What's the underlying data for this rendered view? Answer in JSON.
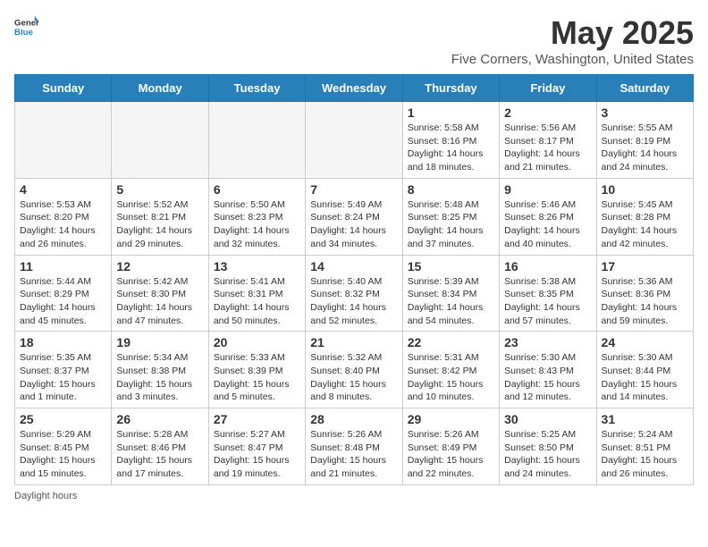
{
  "header": {
    "logo_general": "General",
    "logo_blue": "Blue",
    "title": "May 2025",
    "subtitle": "Five Corners, Washington, United States"
  },
  "weekdays": [
    "Sunday",
    "Monday",
    "Tuesday",
    "Wednesday",
    "Thursday",
    "Friday",
    "Saturday"
  ],
  "weeks": [
    [
      {
        "day": "",
        "info": ""
      },
      {
        "day": "",
        "info": ""
      },
      {
        "day": "",
        "info": ""
      },
      {
        "day": "",
        "info": ""
      },
      {
        "day": "1",
        "info": "Sunrise: 5:58 AM\nSunset: 8:16 PM\nDaylight: 14 hours\nand 18 minutes."
      },
      {
        "day": "2",
        "info": "Sunrise: 5:56 AM\nSunset: 8:17 PM\nDaylight: 14 hours\nand 21 minutes."
      },
      {
        "day": "3",
        "info": "Sunrise: 5:55 AM\nSunset: 8:19 PM\nDaylight: 14 hours\nand 24 minutes."
      }
    ],
    [
      {
        "day": "4",
        "info": "Sunrise: 5:53 AM\nSunset: 8:20 PM\nDaylight: 14 hours\nand 26 minutes."
      },
      {
        "day": "5",
        "info": "Sunrise: 5:52 AM\nSunset: 8:21 PM\nDaylight: 14 hours\nand 29 minutes."
      },
      {
        "day": "6",
        "info": "Sunrise: 5:50 AM\nSunset: 8:23 PM\nDaylight: 14 hours\nand 32 minutes."
      },
      {
        "day": "7",
        "info": "Sunrise: 5:49 AM\nSunset: 8:24 PM\nDaylight: 14 hours\nand 34 minutes."
      },
      {
        "day": "8",
        "info": "Sunrise: 5:48 AM\nSunset: 8:25 PM\nDaylight: 14 hours\nand 37 minutes."
      },
      {
        "day": "9",
        "info": "Sunrise: 5:46 AM\nSunset: 8:26 PM\nDaylight: 14 hours\nand 40 minutes."
      },
      {
        "day": "10",
        "info": "Sunrise: 5:45 AM\nSunset: 8:28 PM\nDaylight: 14 hours\nand 42 minutes."
      }
    ],
    [
      {
        "day": "11",
        "info": "Sunrise: 5:44 AM\nSunset: 8:29 PM\nDaylight: 14 hours\nand 45 minutes."
      },
      {
        "day": "12",
        "info": "Sunrise: 5:42 AM\nSunset: 8:30 PM\nDaylight: 14 hours\nand 47 minutes."
      },
      {
        "day": "13",
        "info": "Sunrise: 5:41 AM\nSunset: 8:31 PM\nDaylight: 14 hours\nand 50 minutes."
      },
      {
        "day": "14",
        "info": "Sunrise: 5:40 AM\nSunset: 8:32 PM\nDaylight: 14 hours\nand 52 minutes."
      },
      {
        "day": "15",
        "info": "Sunrise: 5:39 AM\nSunset: 8:34 PM\nDaylight: 14 hours\nand 54 minutes."
      },
      {
        "day": "16",
        "info": "Sunrise: 5:38 AM\nSunset: 8:35 PM\nDaylight: 14 hours\nand 57 minutes."
      },
      {
        "day": "17",
        "info": "Sunrise: 5:36 AM\nSunset: 8:36 PM\nDaylight: 14 hours\nand 59 minutes."
      }
    ],
    [
      {
        "day": "18",
        "info": "Sunrise: 5:35 AM\nSunset: 8:37 PM\nDaylight: 15 hours\nand 1 minute."
      },
      {
        "day": "19",
        "info": "Sunrise: 5:34 AM\nSunset: 8:38 PM\nDaylight: 15 hours\nand 3 minutes."
      },
      {
        "day": "20",
        "info": "Sunrise: 5:33 AM\nSunset: 8:39 PM\nDaylight: 15 hours\nand 5 minutes."
      },
      {
        "day": "21",
        "info": "Sunrise: 5:32 AM\nSunset: 8:40 PM\nDaylight: 15 hours\nand 8 minutes."
      },
      {
        "day": "22",
        "info": "Sunrise: 5:31 AM\nSunset: 8:42 PM\nDaylight: 15 hours\nand 10 minutes."
      },
      {
        "day": "23",
        "info": "Sunrise: 5:30 AM\nSunset: 8:43 PM\nDaylight: 15 hours\nand 12 minutes."
      },
      {
        "day": "24",
        "info": "Sunrise: 5:30 AM\nSunset: 8:44 PM\nDaylight: 15 hours\nand 14 minutes."
      }
    ],
    [
      {
        "day": "25",
        "info": "Sunrise: 5:29 AM\nSunset: 8:45 PM\nDaylight: 15 hours\nand 15 minutes."
      },
      {
        "day": "26",
        "info": "Sunrise: 5:28 AM\nSunset: 8:46 PM\nDaylight: 15 hours\nand 17 minutes."
      },
      {
        "day": "27",
        "info": "Sunrise: 5:27 AM\nSunset: 8:47 PM\nDaylight: 15 hours\nand 19 minutes."
      },
      {
        "day": "28",
        "info": "Sunrise: 5:26 AM\nSunset: 8:48 PM\nDaylight: 15 hours\nand 21 minutes."
      },
      {
        "day": "29",
        "info": "Sunrise: 5:26 AM\nSunset: 8:49 PM\nDaylight: 15 hours\nand 22 minutes."
      },
      {
        "day": "30",
        "info": "Sunrise: 5:25 AM\nSunset: 8:50 PM\nDaylight: 15 hours\nand 24 minutes."
      },
      {
        "day": "31",
        "info": "Sunrise: 5:24 AM\nSunset: 8:51 PM\nDaylight: 15 hours\nand 26 minutes."
      }
    ]
  ],
  "footer": {
    "note": "Daylight hours"
  }
}
